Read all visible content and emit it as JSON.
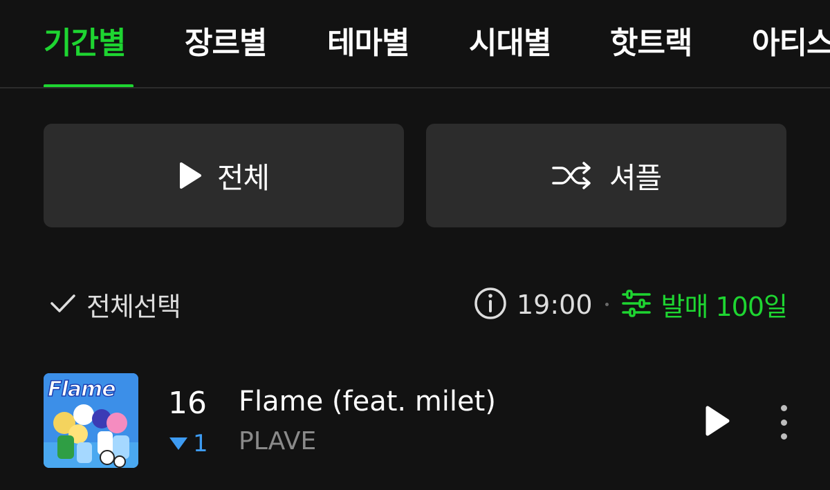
{
  "tabs": [
    {
      "label": "기간별",
      "active": true
    },
    {
      "label": "장르별",
      "active": false
    },
    {
      "label": "테마별",
      "active": false
    },
    {
      "label": "시대별",
      "active": false
    },
    {
      "label": "핫트랙",
      "active": false
    },
    {
      "label": "아티스",
      "active": false
    }
  ],
  "actions": {
    "play_all_label": "전체",
    "shuffle_label": "셔플"
  },
  "toolbar": {
    "select_all_label": "전체선택",
    "update_time": "19:00",
    "filter_label": "발매 100일"
  },
  "tracks": [
    {
      "cover_text": "Flame",
      "rank": "16",
      "rank_change": "1",
      "rank_direction": "down",
      "title": "Flame (feat. milet)",
      "artist": "PLAVE"
    }
  ],
  "colors": {
    "accent": "#1ed531",
    "background": "#121212",
    "button_bg": "#2c2c2c",
    "rank_down": "#3d9bf2"
  },
  "icons": {
    "play": "play-icon",
    "shuffle": "shuffle-icon",
    "check": "check-icon",
    "info": "info-icon",
    "filter": "sliders-icon",
    "more": "more-vertical-icon"
  }
}
